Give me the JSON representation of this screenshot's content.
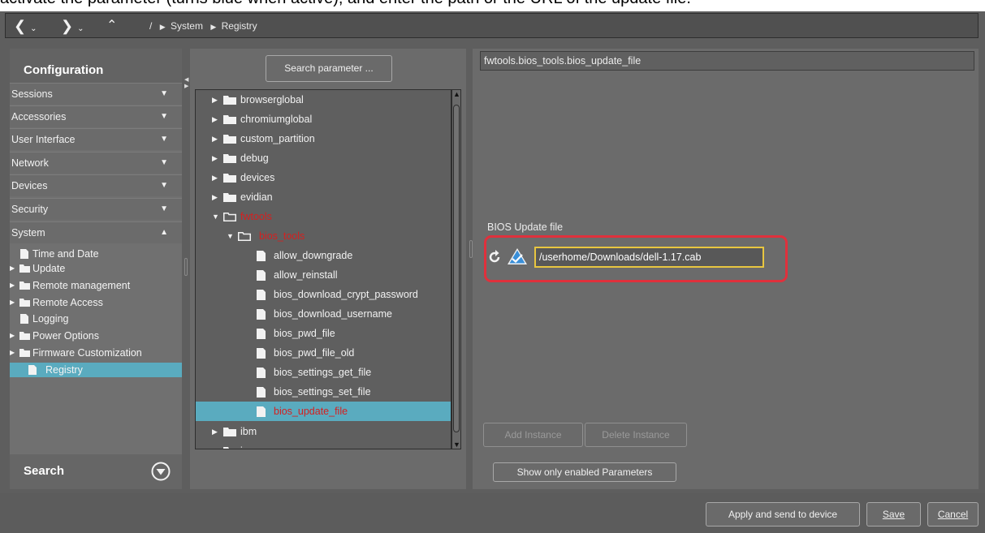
{
  "caption": {
    "text": "activate the parameter (turns blue when active), and enter the path or the URL of the update file."
  },
  "navbar": {
    "root": "/",
    "crumbs": [
      "System",
      "Registry"
    ]
  },
  "left_panel": {
    "title": "Configuration",
    "categories": [
      {
        "label": "Sessions",
        "arrow": "▼"
      },
      {
        "label": "Accessories",
        "arrow": "▼"
      },
      {
        "label": "User Interface",
        "arrow": "▼"
      },
      {
        "label": "Network",
        "arrow": "▼"
      },
      {
        "label": "Devices",
        "arrow": "▼"
      },
      {
        "label": "Security",
        "arrow": "▼"
      },
      {
        "label": "System",
        "arrow": "▲"
      }
    ],
    "system_items": [
      {
        "label": "Time and Date",
        "type": "file",
        "expandable": false
      },
      {
        "label": "Update",
        "type": "folder",
        "expandable": true
      },
      {
        "label": "Remote management",
        "type": "folder",
        "expandable": true
      },
      {
        "label": "Remote Access",
        "type": "folder",
        "expandable": true
      },
      {
        "label": "Logging",
        "type": "file",
        "expandable": false
      },
      {
        "label": "Power Options",
        "type": "folder",
        "expandable": true
      },
      {
        "label": "Firmware Customization",
        "type": "folder",
        "expandable": true
      },
      {
        "label": "Registry",
        "type": "file",
        "expandable": false,
        "selected": true
      }
    ],
    "search_label": "Search"
  },
  "middle_panel": {
    "search_button": "Search parameter ...",
    "tree": [
      {
        "label": "browserglobal",
        "type": "folder",
        "level": 0,
        "state": "collapsed"
      },
      {
        "label": "chromiumglobal",
        "type": "folder",
        "level": 0,
        "state": "collapsed"
      },
      {
        "label": "custom_partition",
        "type": "folder",
        "level": 0,
        "state": "collapsed"
      },
      {
        "label": "debug",
        "type": "folder",
        "level": 0,
        "state": "collapsed"
      },
      {
        "label": "devices",
        "type": "folder",
        "level": 0,
        "state": "collapsed"
      },
      {
        "label": "evidian",
        "type": "folder",
        "level": 0,
        "state": "collapsed"
      },
      {
        "label": "fwtools",
        "type": "folder",
        "level": 0,
        "state": "expanded",
        "highlight": true
      },
      {
        "label": "bios_tools",
        "type": "folder",
        "level": 1,
        "state": "expanded",
        "highlight": true
      },
      {
        "label": "allow_downgrade",
        "type": "file",
        "level": 2
      },
      {
        "label": "allow_reinstall",
        "type": "file",
        "level": 2
      },
      {
        "label": "bios_download_crypt_password",
        "type": "file",
        "level": 2
      },
      {
        "label": "bios_download_username",
        "type": "file",
        "level": 2
      },
      {
        "label": "bios_pwd_file",
        "type": "file",
        "level": 2
      },
      {
        "label": "bios_pwd_file_old",
        "type": "file",
        "level": 2
      },
      {
        "label": "bios_settings_get_file",
        "type": "file",
        "level": 2
      },
      {
        "label": "bios_settings_set_file",
        "type": "file",
        "level": 2
      },
      {
        "label": "bios_update_file",
        "type": "file",
        "level": 2,
        "selected": true,
        "highlight": true
      },
      {
        "label": "ibm",
        "type": "folder",
        "level": 0,
        "state": "collapsed"
      },
      {
        "label": "ica",
        "type": "folder",
        "level": 0,
        "state": "collapsed"
      }
    ]
  },
  "right_panel": {
    "path": "fwtools.bios_tools.bios_update_file",
    "param_label": "BIOS Update file",
    "param_value": "/userhome/Downloads/dell-1.17.cab",
    "add_instance": "Add Instance",
    "delete_instance": "Delete Instance",
    "show_enabled": "Show only enabled Parameters",
    "highlight_color": "#e0303c"
  },
  "bottom_bar": {
    "apply": "Apply and send to device",
    "save": "Save",
    "cancel": "Cancel"
  },
  "colors": {
    "selection": "#5aabbf",
    "active_text": "#d42020",
    "field_border": "#e8c640",
    "check_blue": "#3a8fd8"
  }
}
